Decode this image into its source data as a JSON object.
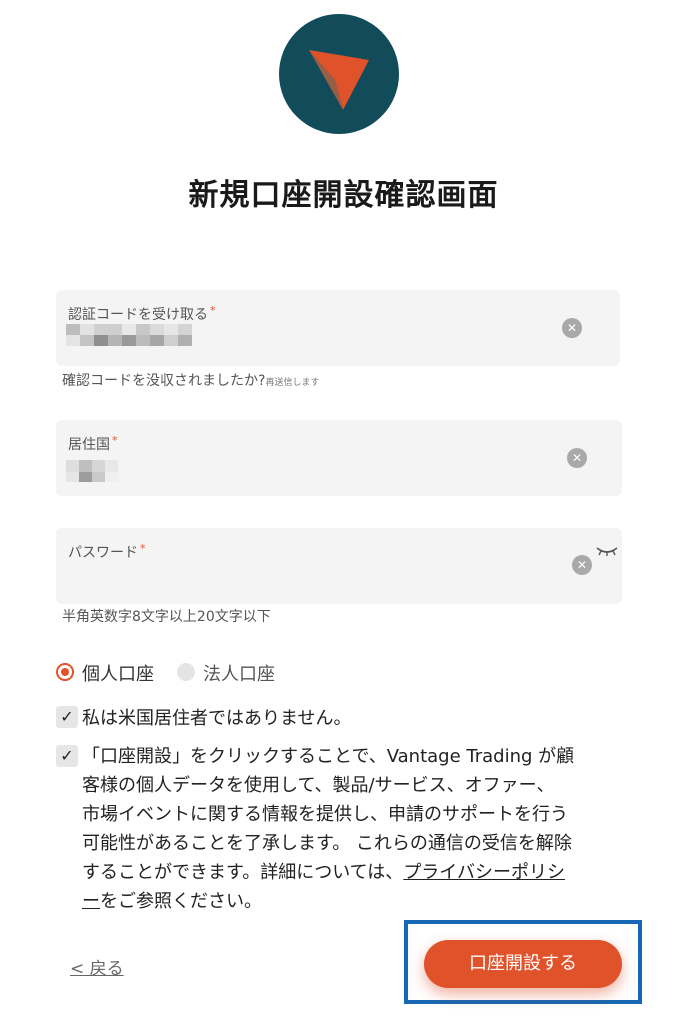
{
  "header": {
    "title": "新規口座開設確認画面",
    "logo_icon": "arrow-pointer-icon"
  },
  "form": {
    "verification_code": {
      "label": "認証コードを受け取る",
      "required_mark": "*",
      "value_masked": true
    },
    "verification_help": {
      "text": "確認コードを没収されましたか?",
      "resend": "再送信します"
    },
    "country": {
      "label": "居住国",
      "required_mark": "*",
      "value_masked": true
    },
    "password": {
      "label": "パスワード",
      "required_mark": "*",
      "value": ""
    },
    "password_help": "半角英数字8文字以上20文字以下"
  },
  "account_type": {
    "options": [
      {
        "label": "個人口座",
        "selected": true
      },
      {
        "label": "法人口座",
        "selected": false
      }
    ]
  },
  "checkboxes": {
    "us_resident": {
      "checked": true,
      "label": "私は米国居住者ではありません。"
    },
    "consent": {
      "checked": true,
      "lines": [
        "「口座開設」をクリックすることで、Vantage Trading が顧",
        "客様の個人データを使用して、製品/サービス、オファー、",
        "市場イベントに関する情報を提供し、申請のサポートを行う",
        "可能性があることを了承します。 これらの通信の受信を解除",
        "することができます。詳細については、"
      ],
      "link_part1": "プライバシーポリシ",
      "link_part2": "ー",
      "tail": "をご参照ください。"
    }
  },
  "actions": {
    "back_label": "< 戻る",
    "submit_label": "口座開設する"
  },
  "colors": {
    "accent": "#e0522a",
    "logo_bg": "#124b59",
    "highlight": "#1668b3",
    "field_bg": "#f4f4f4"
  }
}
